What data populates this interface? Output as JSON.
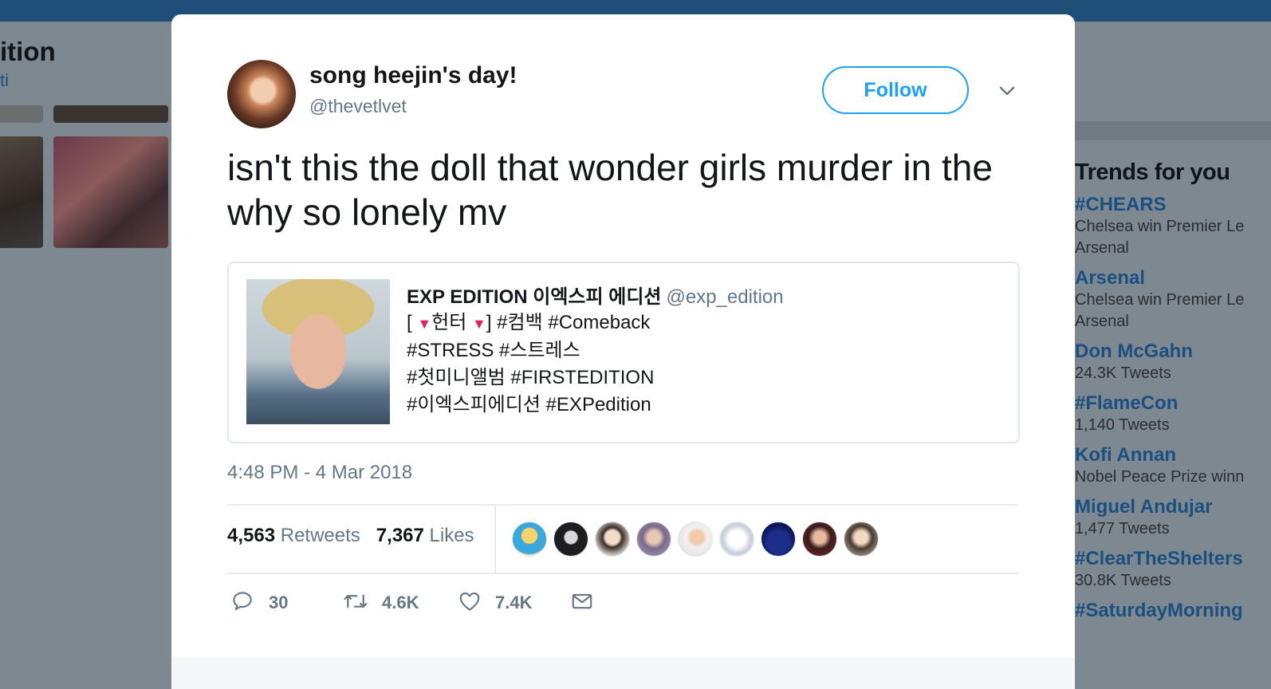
{
  "background": {
    "left_title": "ition",
    "left_subtitle": "ti",
    "trends_title": "Trends for you",
    "trends": [
      {
        "name": "#CHEARS",
        "sub": "Chelsea win Premier Le",
        "sub2": "Arsenal"
      },
      {
        "name": "Arsenal",
        "sub": "Chelsea win Premier Le",
        "sub2": "Arsenal"
      },
      {
        "name": "Don McGahn",
        "sub": "24.3K Tweets"
      },
      {
        "name": "#FlameCon",
        "sub": "1,140 Tweets"
      },
      {
        "name": "Kofi Annan",
        "sub": "Nobel Peace Prize winn"
      },
      {
        "name": "Miguel Andujar",
        "sub": "1,477 Tweets"
      },
      {
        "name": "#ClearTheShelters",
        "sub": "30.8K Tweets"
      },
      {
        "name": "#SaturdayMorning",
        "sub": ""
      }
    ]
  },
  "tweet": {
    "display_name": "song heejin's day!",
    "handle": "@thevetlvet",
    "follow_label": "Follow",
    "text": "isn't this the doll that wonder girls murder in the why so lonely mv",
    "timestamp": "4:48 PM - 4 Mar 2018",
    "quote": {
      "name": "EXP EDITION 이엑스피 에디션",
      "handle": "@exp_edition",
      "line1_open": "[",
      "line1_word": "헌터",
      "line1_rest": "] #컴백 #Comeback",
      "line2": "#STRESS #스트레스",
      "line3": "#첫미니앨범 #FIRSTEDITION",
      "line4": "#이엑스피에디션 #EXPedition"
    },
    "stats": {
      "retweets_count": "4,563",
      "retweets_label": "Retweets",
      "likes_count": "7,367",
      "likes_label": "Likes"
    },
    "actions": {
      "reply_count": "30",
      "retweet_count": "4.6K",
      "like_count": "7.4K"
    },
    "icons": {
      "reply": "reply-icon",
      "retweet": "retweet-icon",
      "like": "heart-icon",
      "message": "envelope-icon",
      "caret": "chevron-down-icon"
    }
  },
  "colors": {
    "accent": "#1da1f2",
    "trend_link": "#1b4f80",
    "muted": "#657786",
    "text": "#14171a",
    "triangle": "#e0245e"
  }
}
